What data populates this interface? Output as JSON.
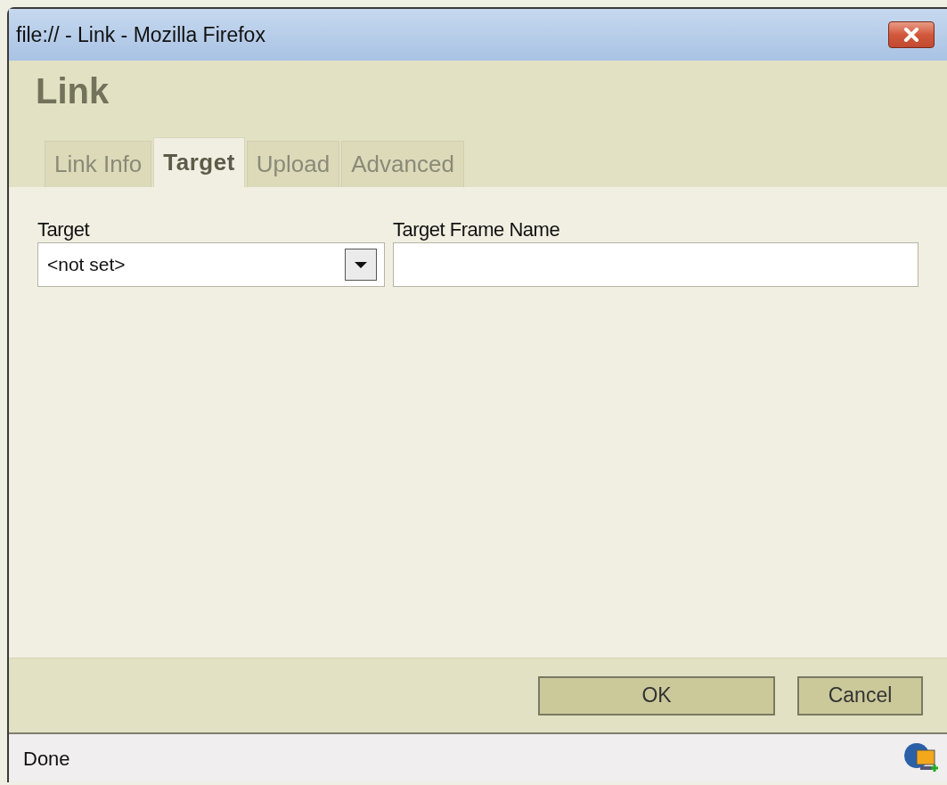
{
  "window": {
    "title": "file:// - Link - Mozilla Firefox"
  },
  "dialog": {
    "title": "Link"
  },
  "tabs": [
    {
      "label": "Link Info",
      "selected": false
    },
    {
      "label": "Target",
      "selected": true
    },
    {
      "label": "Upload",
      "selected": false
    },
    {
      "label": "Advanced",
      "selected": false
    }
  ],
  "target": {
    "label": "Target",
    "value": "<not set>"
  },
  "frame_name": {
    "label": "Target Frame Name"
  },
  "buttons": [
    {
      "label": "OK",
      "kind": "primary"
    },
    {
      "label": "Cancel",
      "kind": "secondary"
    }
  ],
  "status_bar": {
    "text": "Done"
  }
}
